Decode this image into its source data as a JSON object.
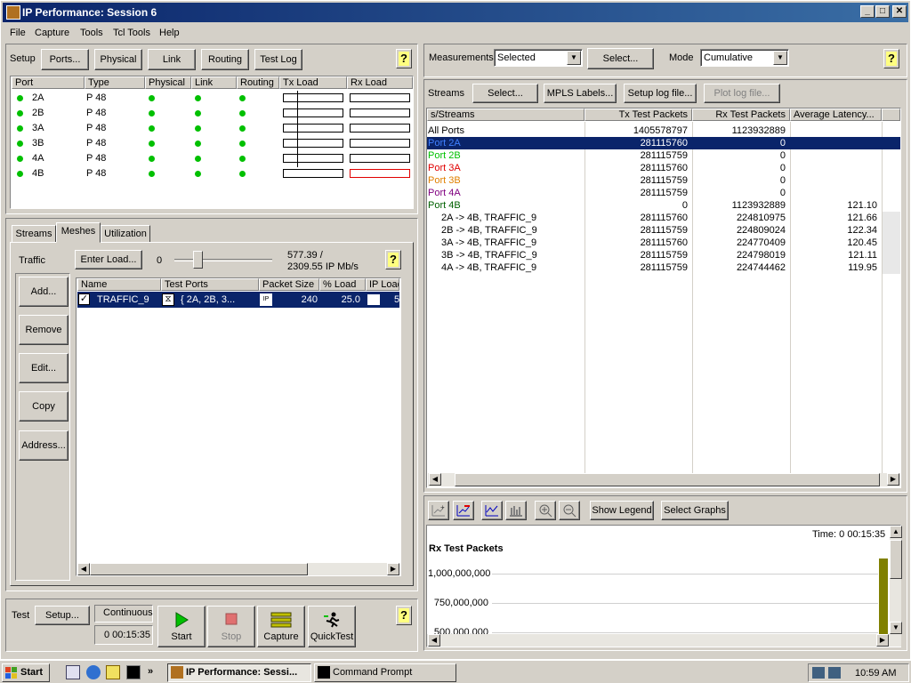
{
  "window": {
    "title": "IP Performance: Session 6"
  },
  "menu": [
    "File",
    "Capture",
    "Tools",
    "Tcl Tools",
    "Help"
  ],
  "setup": {
    "label": "Setup",
    "buttons": [
      "Ports...",
      "Physical",
      "Link",
      "Routing",
      "Test Log"
    ],
    "help": "?"
  },
  "ports_table": {
    "headers": [
      "Port",
      "Type",
      "Physical",
      "Link",
      "Routing",
      "Tx Load",
      "Rx Load"
    ],
    "rows": [
      {
        "port": "2A",
        "type": "P 48"
      },
      {
        "port": "2B",
        "type": "P 48"
      },
      {
        "port": "3A",
        "type": "P 48"
      },
      {
        "port": "3B",
        "type": "P 48"
      },
      {
        "port": "4A",
        "type": "P 48"
      },
      {
        "port": "4B",
        "type": "P 48"
      }
    ]
  },
  "tabs": [
    "Streams",
    "Meshes",
    "Utilization"
  ],
  "traffic": {
    "label": "Traffic",
    "enter_load": "Enter Load...",
    "slider_min": "0",
    "rate_line1": "577.39 /",
    "rate_line2": "2309.55 IP Mb/s",
    "slider_level": 0.15
  },
  "side_buttons": [
    "Add...",
    "Remove",
    "Edit...",
    "Copy",
    "Address..."
  ],
  "mesh_table": {
    "headers": [
      "Name",
      "Test Ports",
      "Packet Size",
      "% Load",
      "IP Load"
    ],
    "row": {
      "name": "TRAFFIC_9",
      "ports": "{ 2A, 2B, 3...",
      "ip_tag": "IP",
      "size": "240",
      "load": "25.0",
      "ip_load": "5"
    }
  },
  "test": {
    "label": "Test",
    "setup": "Setup...",
    "mode": "Continuous",
    "elapsed": "0 00:15:35",
    "actions": [
      "Start",
      "Stop",
      "Capture",
      "QuickTest"
    ]
  },
  "measurements": {
    "label": "Measurements",
    "selected": "Selected",
    "select_btn": "Select...",
    "mode_label": "Mode",
    "mode_value": "Cumulative"
  },
  "streams_bar": {
    "label": "Streams",
    "buttons": [
      "Select...",
      "MPLS Labels...",
      "Setup log file...",
      "Plot log file..."
    ]
  },
  "stats_table": {
    "headers": [
      "s/Streams",
      "Tx Test Packets",
      "Rx Test Packets",
      "Average Latency..."
    ],
    "rows": [
      {
        "name": "All Ports",
        "tx": "1405578797",
        "rx": "1123932889",
        "lat": "",
        "color": "#000000"
      },
      {
        "name": "Port 2A",
        "tx": "281115760",
        "rx": "0",
        "lat": "",
        "color": "#4080ff"
      },
      {
        "name": "Port 2B",
        "tx": "281115759",
        "rx": "0",
        "lat": "",
        "color": "#00c000"
      },
      {
        "name": "Port 3A",
        "tx": "281115760",
        "rx": "0",
        "lat": "",
        "color": "#e00000"
      },
      {
        "name": "Port 3B",
        "tx": "281115759",
        "rx": "0",
        "lat": "",
        "color": "#e08000"
      },
      {
        "name": "Port 4A",
        "tx": "281115759",
        "rx": "0",
        "lat": "",
        "color": "#800080"
      },
      {
        "name": "Port 4B",
        "tx": "0",
        "rx": "1123932889",
        "lat": "121.10",
        "color": "#006000"
      },
      {
        "name": "2A -> 4B, TRAFFIC_9",
        "tx": "281115760",
        "rx": "224810975",
        "lat": "121.66",
        "color": "#000000"
      },
      {
        "name": "2B -> 4B, TRAFFIC_9",
        "tx": "281115759",
        "rx": "224809024",
        "lat": "122.34",
        "color": "#000000"
      },
      {
        "name": "3A -> 4B, TRAFFIC_9",
        "tx": "281115760",
        "rx": "224770409",
        "lat": "120.45",
        "color": "#000000"
      },
      {
        "name": "3B -> 4B, TRAFFIC_9",
        "tx": "281115759",
        "rx": "224798019",
        "lat": "121.11",
        "color": "#000000"
      },
      {
        "name": "4A -> 4B, TRAFFIC_9",
        "tx": "281115759",
        "rx": "224744462",
        "lat": "119.95",
        "color": "#000000"
      }
    ]
  },
  "graph": {
    "show_legend": "Show Legend",
    "select_graphs": "Select Graphs",
    "time": "Time:  0 00:15:35",
    "title": "Rx Test Packets",
    "y_ticks": [
      "1,000,000,000",
      "750,000,000",
      "500,000,000"
    ],
    "bar_color": "#808000"
  },
  "taskbar": {
    "start": "Start",
    "apps": [
      "IP Performance: Sessi...",
      "Command Prompt"
    ],
    "clock": "10:59 AM"
  }
}
